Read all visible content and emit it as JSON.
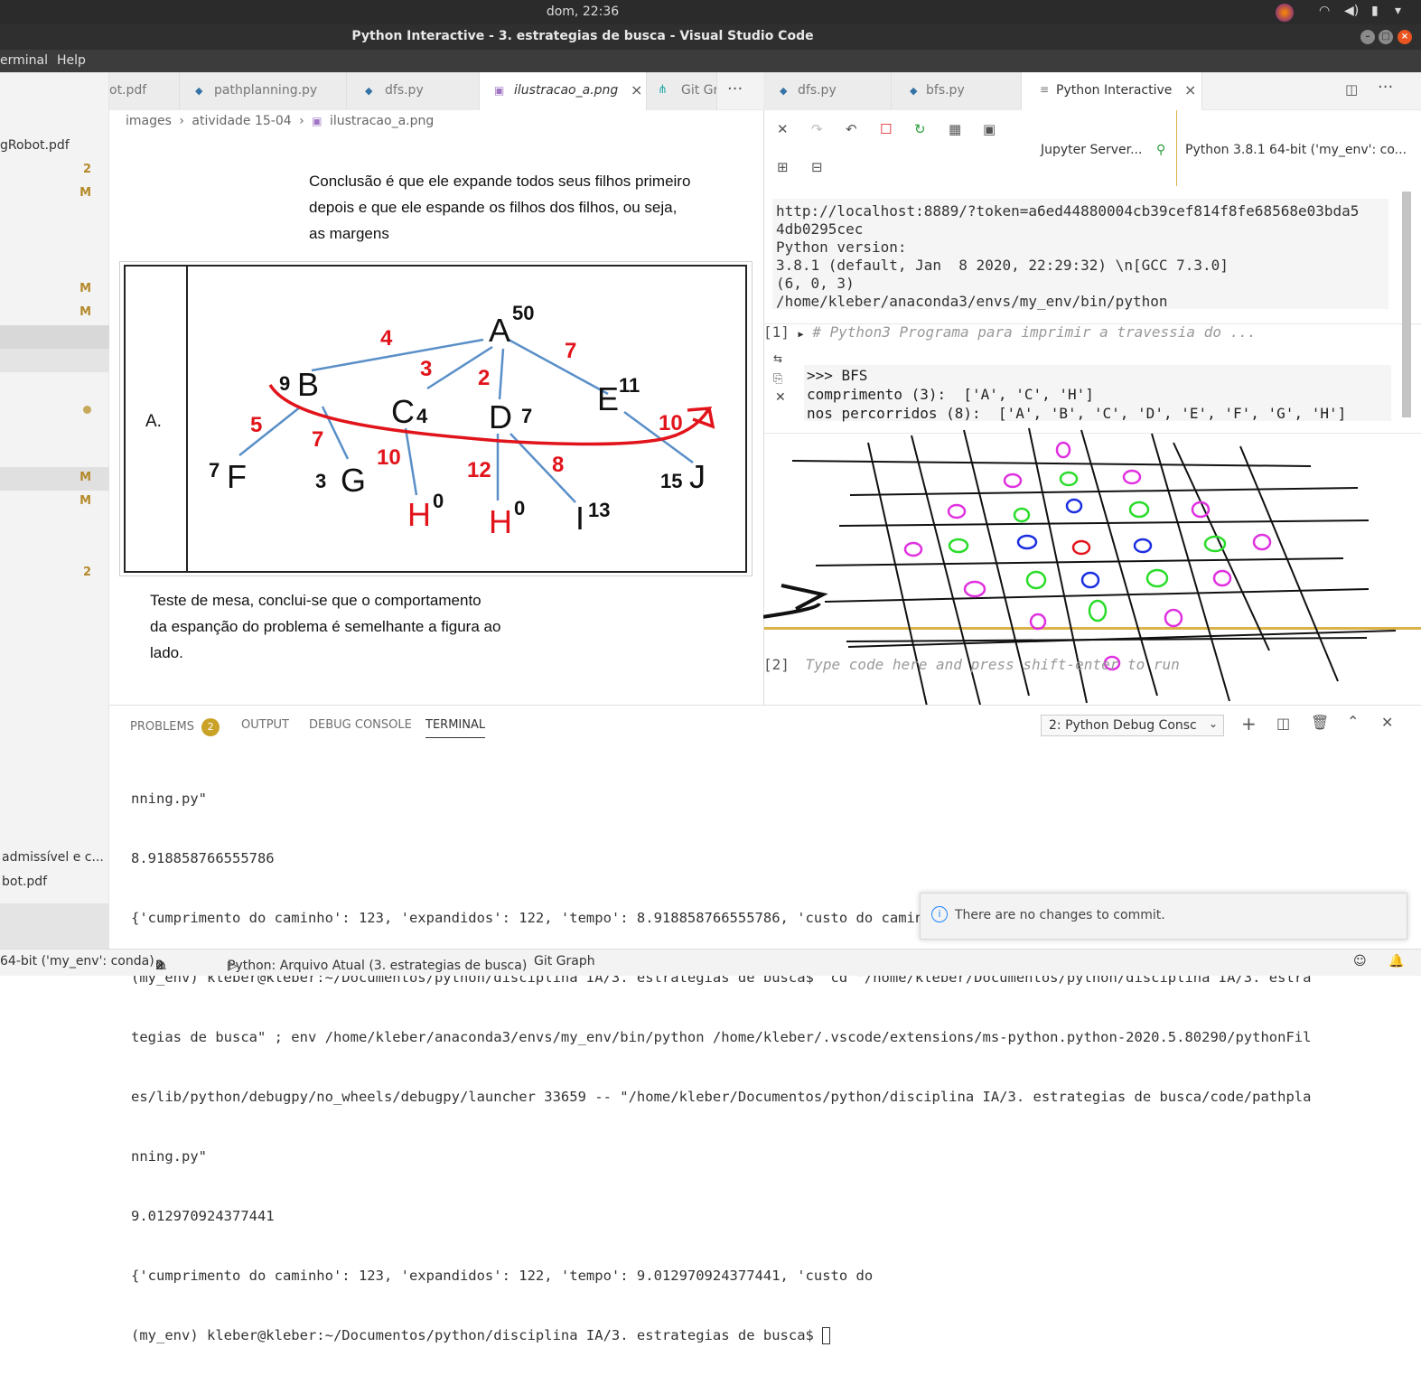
{
  "system": {
    "clock": "dom, 22:36"
  },
  "window": {
    "title": "Python Interactive - 3. estrategias de busca - Visual Studio Code"
  },
  "menu": {
    "items": [
      "erminal",
      "Help"
    ]
  },
  "explorer": {
    "rows": [
      {
        "label": "gRobot.pdf",
        "badge": ""
      },
      {
        "label": "",
        "badge": "2"
      },
      {
        "label": "",
        "badge": "M"
      },
      {
        "label": "",
        "badge": "M"
      },
      {
        "label": "",
        "badge": "M"
      },
      {
        "label": "",
        "badge": "M"
      },
      {
        "label": "",
        "badge": "M"
      },
      {
        "label": "",
        "badge": "2"
      },
      {
        "label": "admissível e c...",
        "badge": ""
      },
      {
        "label": "bot.pdf",
        "badge": ""
      }
    ]
  },
  "tabs_left": [
    {
      "label": "ot.pdf"
    },
    {
      "label": "pathplanning.py"
    },
    {
      "label": "dfs.py"
    },
    {
      "label": "ilustracao_a.png"
    },
    {
      "label": "Git Gr"
    }
  ],
  "tabs_right": [
    {
      "label": "dfs.py"
    },
    {
      "label": "bfs.py"
    },
    {
      "label": "Python Interactive"
    }
  ],
  "breadcrumb": {
    "a": "images",
    "b": "atividade 15-04",
    "c": "ilustracao_a.png"
  },
  "image": {
    "note_top": [
      "Conclusão é que ele expande todos seus filhos primeiro",
      "depois e que ele espande os filhos dos filhos, ou seja,",
      "as margens"
    ],
    "note_bottom": [
      "Teste de mesa, conclui-se que o comportamento",
      "da espanção do problema é semelhante a figura ao",
      "lado."
    ],
    "fig_label": "A.",
    "nodes": [
      {
        "id": "A",
        "h": "50"
      },
      {
        "id": "B",
        "h": "9"
      },
      {
        "id": "C",
        "h": "4"
      },
      {
        "id": "D",
        "h": "7"
      },
      {
        "id": "E",
        "h": "11"
      },
      {
        "id": "F",
        "h": "7"
      },
      {
        "id": "G",
        "h": "3"
      },
      {
        "id": "H",
        "h": "0"
      },
      {
        "id": "H",
        "h": "0"
      },
      {
        "id": "I",
        "h": "13"
      },
      {
        "id": "J",
        "h": "15"
      }
    ],
    "edge_costs": [
      "4",
      "3",
      "2",
      "7",
      "5",
      "7",
      "10",
      "12",
      "8",
      "10"
    ],
    "colors": {
      "edge": "#5a8fc8",
      "cost": "#e2141b",
      "path": "#e2141b"
    }
  },
  "interactive": {
    "server": "Jupyter Server...",
    "kernel": "Python 3.8.1 64-bit ('my_env': co...",
    "output1": "http://localhost:8889/?token=a6ed44880004cb39cef814f8fe68568e03bda5\n4db0295cec\nPython version:\n3.8.1 (default, Jan  8 2020, 22:29:32) \\n[GCC 7.3.0]\n(6, 0, 3)\n/home/kleber/anaconda3/envs/my_env/bin/python",
    "cell1_label": "[1]",
    "cell1_code": "# Python3 Programa para imprimir a travessia do ...",
    "bfs_output": ">>> BFS\ncomprimento (3):  ['A', 'C', 'H']\nnos percorridos (8):  ['A', 'B', 'C', 'D', 'E', 'F', 'G', 'H']",
    "cell2_label": "[2]",
    "cell2_placeholder": "Type code here and press shift-enter to run"
  },
  "panel": {
    "tabs": [
      "PROBLEMS",
      "OUTPUT",
      "DEBUG CONSOLE",
      "TERMINAL"
    ],
    "problems_count": "2",
    "terminal_select": "2: Python Debug Consc",
    "terminal_lines": [
      "nning.py\"",
      "8.918858766555786",
      "{'cumprimento do caminho': 123, 'expandidos': 122, 'tempo': 8.918858766555786, 'custo do caminho': 0}",
      "(my_env) kleber@kleber:~/Documentos/python/disciplina IA/3. estrategias de busca$  cd \"/home/kleber/Documentos/python/disciplina IA/3. estra",
      "tegias de busca\" ; env /home/kleber/anaconda3/envs/my_env/bin/python /home/kleber/.vscode/extensions/ms-python.python-2020.5.80290/pythonFil",
      "es/lib/python/debugpy/no_wheels/debugpy/launcher 33659 -- \"/home/kleber/Documentos/python/disciplina IA/3. estrategias de busca/code/pathpla",
      "nning.py\"",
      "9.012970924377441",
      "{'cumprimento do caminho': 123, 'expandidos': 122, 'tempo': 9.012970924377441, 'custo do",
      "(my_env) kleber@kleber:~/Documentos/python/disciplina IA/3. estrategias de busca$ "
    ]
  },
  "notification": {
    "text": "There are no changes to commit."
  },
  "status": {
    "interpreter": "64-bit ('my_env': conda)",
    "errors": "0",
    "warnings": "2",
    "run": "Python: Arquivo Atual (3. estrategias de busca)",
    "git": "Git Graph"
  }
}
